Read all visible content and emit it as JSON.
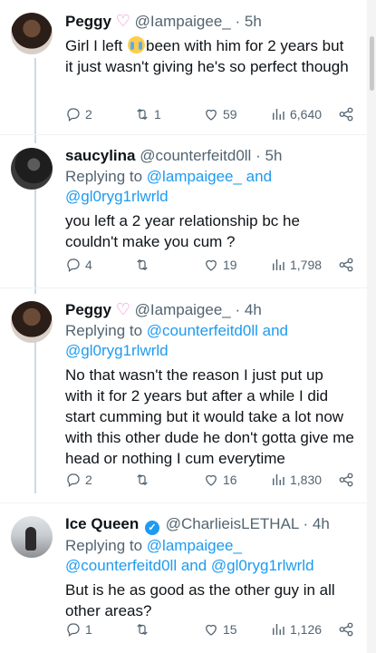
{
  "tweets": [
    {
      "name": "Peggy",
      "handle": "@Iampaigee_",
      "time": "5h",
      "body_before": "Girl I left ",
      "body_after": "been with him for 2 years but it just wasn't giving he's so perfect though",
      "emoji": "loudly-crying-face",
      "replies": "2",
      "retweets": "1",
      "likes": "59",
      "views": "6,640"
    },
    {
      "name": "saucylina",
      "handle": "@counterfeitd0ll",
      "time": "5h",
      "reply_prefix": "Replying to",
      "reply_mentions": "@lampaigee_ and @gl0ryg1rlwrld",
      "body": "you left a 2 year relationship bc he couldn't make you cum ?",
      "replies": "4",
      "retweets": "",
      "likes": "19",
      "views": "1,798"
    },
    {
      "name": "Peggy",
      "handle": "@Iampaigee_",
      "time": "4h",
      "reply_prefix": "Replying to",
      "reply_mentions": "@counterfeitd0ll and @gl0ryg1rlwrld",
      "body": "No that wasn't the reason I just put up with it for 2 years but after a while I did start cumming but it would take a lot now with this other dude he don't gotta give me head or nothing I cum everytime",
      "replies": "2",
      "retweets": "",
      "likes": "16",
      "views": "1,830"
    },
    {
      "name": "Ice Queen",
      "handle": "@CharlieisLETHAL",
      "time": "4h",
      "reply_prefix": "Replying to",
      "reply_mentions": "@lampaigee_ @counterfeitd0ll and @gl0ryg1rlwrld",
      "body": "But is he as good as the other guy in all other areas?",
      "replies": "1",
      "retweets": "",
      "likes": "15",
      "views": "1,126"
    }
  ],
  "colors": {
    "accent": "#1d9bf0",
    "secondary_text": "#536471",
    "heart": "#f47fd2",
    "verified": "#1d9bf0"
  },
  "icons": [
    "reply-icon",
    "retweet-icon",
    "like-icon",
    "views-icon",
    "share-icon",
    "verified-badge-icon",
    "pink-heart-emoji"
  ]
}
